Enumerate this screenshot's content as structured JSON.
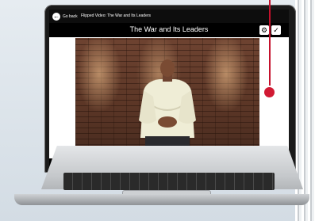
{
  "player": {
    "back_label": "Go back",
    "breadcrumb": "Flipped Video: The War and Its Leaders",
    "video_title": "The War and Its Leaders",
    "icons": {
      "back": "arrow-left-icon",
      "settings": "gear-icon",
      "done": "check-icon"
    }
  },
  "colors": {
    "accent_pin": "#d11a33",
    "topbar": "#0d0d0d",
    "title_bar": "#000000"
  }
}
